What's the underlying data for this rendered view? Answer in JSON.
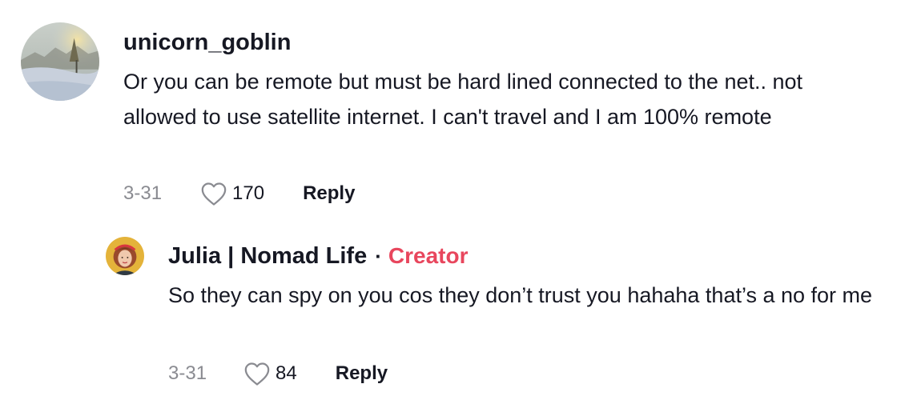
{
  "comment": {
    "username": "unicorn_goblin",
    "text": "Or you can be remote but must be hard lined connected to the net.. not allowed to use satellite internet. I can't travel and I am 100% remote",
    "date": "3-31",
    "likes": "170",
    "reply_label": "Reply",
    "avatar_icon": "winter-landscape-avatar"
  },
  "reply": {
    "username": "Julia | Nomad Life",
    "separator": "·",
    "badge": "Creator",
    "text": "So they can spy on you cos they don’t trust you hahaha that’s a no for me",
    "date": "3-31",
    "likes": "84",
    "reply_label": "Reply",
    "avatar_icon": "woman-portrait-avatar"
  },
  "colors": {
    "creator_badge": "#e8465d",
    "text_primary": "#161823",
    "text_secondary": "#8a8b91"
  }
}
